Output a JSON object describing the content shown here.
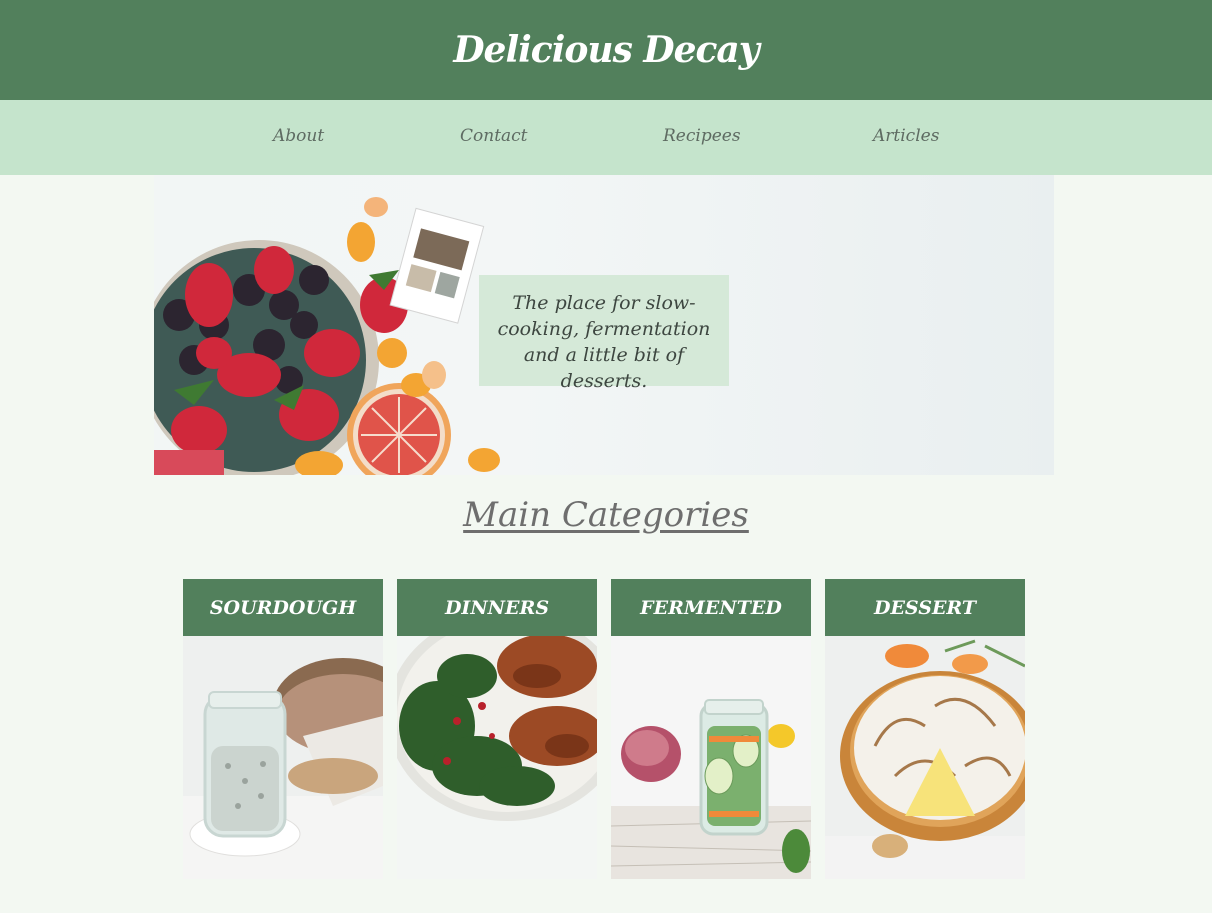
{
  "header": {
    "title": "Delicious Decay",
    "brand_color": "#52805c",
    "nav_bg_color": "#c5e4cc"
  },
  "nav": {
    "items": [
      {
        "label": "About"
      },
      {
        "label": "Contact"
      },
      {
        "label": "Recipees"
      },
      {
        "label": "Articles"
      }
    ]
  },
  "hero": {
    "tagline": "The place for slow-cooking, fermentation and a little bit of desserts.",
    "image": "fruit-bowl-photo"
  },
  "main": {
    "section_title": "Main Categories",
    "categories": [
      {
        "label": "SOURDOUGH",
        "image": "sourdough-jar-photo"
      },
      {
        "label": "DINNERS",
        "image": "chicken-kale-photo"
      },
      {
        "label": "FERMENTED",
        "image": "pickle-jar-photo"
      },
      {
        "label": "DESSERT",
        "image": "meringue-pie-photo"
      }
    ]
  }
}
